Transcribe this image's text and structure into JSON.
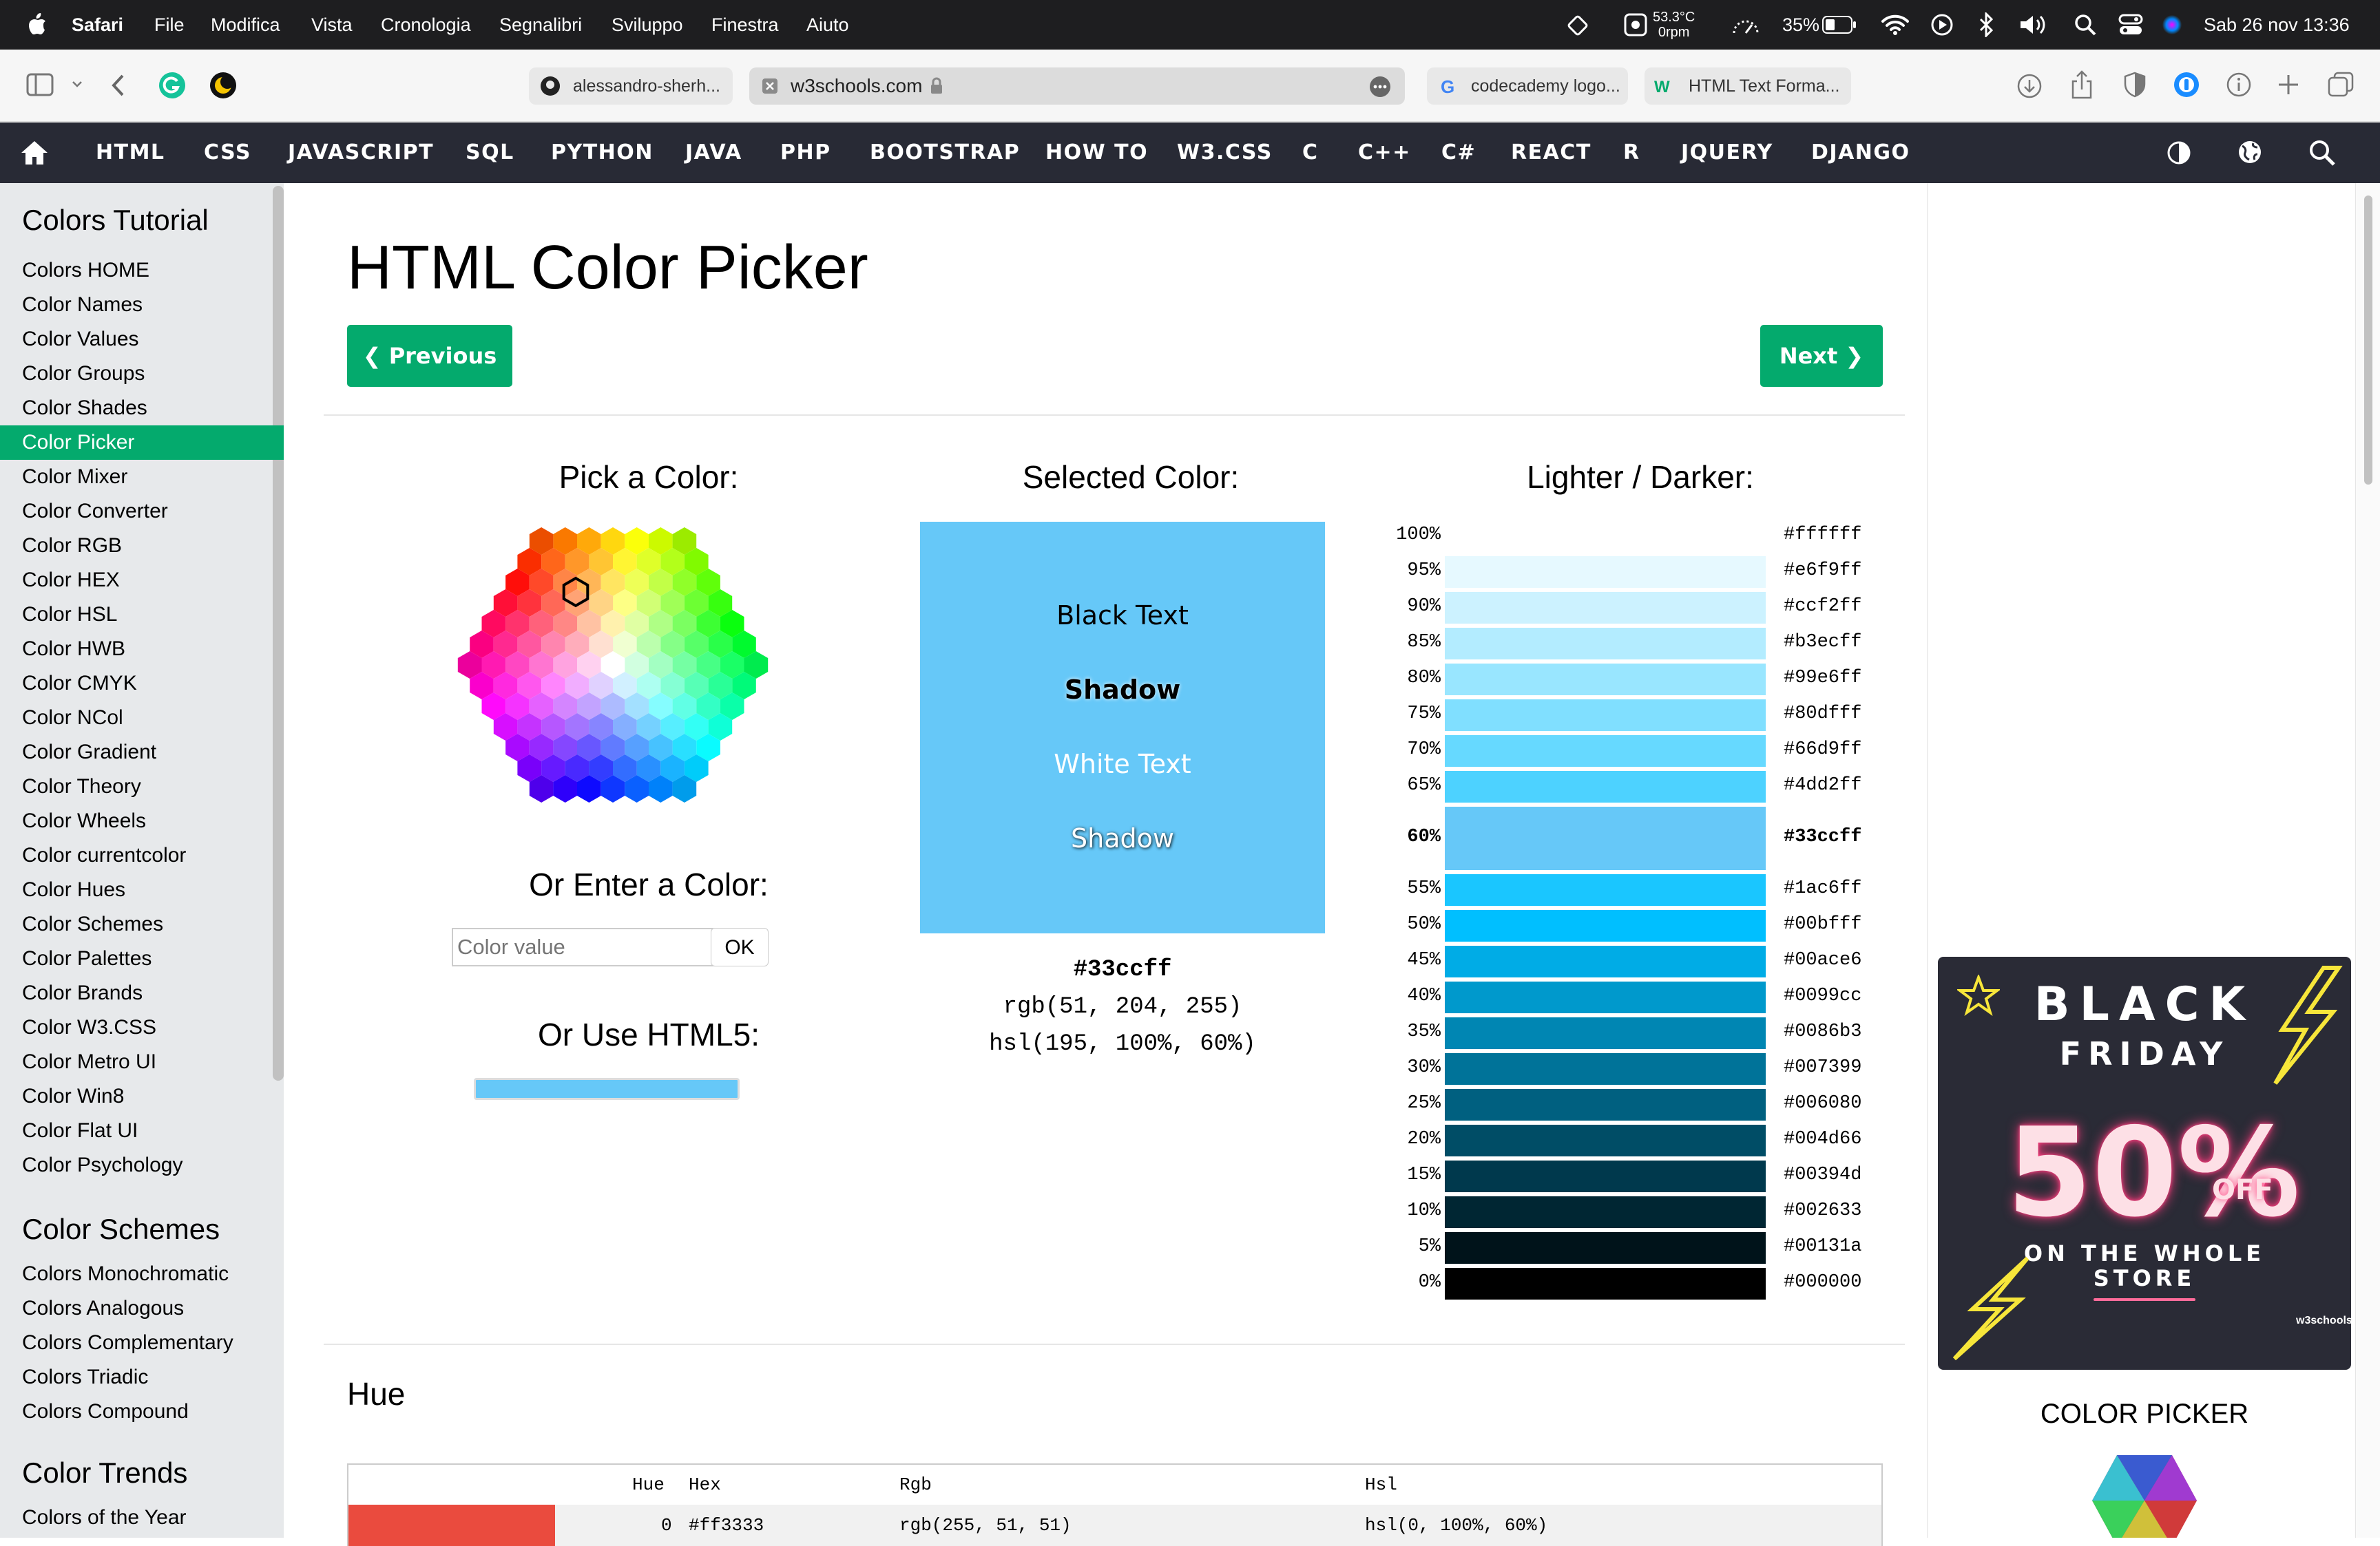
{
  "menubar": {
    "items": [
      "Safari",
      "File",
      "Modifica",
      "Vista",
      "Cronologia",
      "Segnalibri",
      "Sviluppo",
      "Finestra",
      "Aiuto"
    ],
    "temp": "53.3°C",
    "rpm": "0rpm",
    "battery": "35%",
    "datetime": "Sab 26 nov  13:36"
  },
  "tabs": [
    {
      "label": "alessandro-sherh..."
    },
    {
      "label": "w3schools.com"
    },
    {
      "label": "codecademy logo..."
    },
    {
      "label": "HTML Text Forma..."
    }
  ],
  "nav": {
    "items": [
      "HTML",
      "CSS",
      "JAVASCRIPT",
      "SQL",
      "PYTHON",
      "JAVA",
      "PHP",
      "BOOTSTRAP",
      "HOW TO",
      "W3.CSS",
      "C",
      "C++",
      "C#",
      "REACT",
      "R",
      "JQUERY",
      "DJANGO"
    ]
  },
  "sidebar": {
    "heading1": "Colors Tutorial",
    "items1": [
      "Colors HOME",
      "Color Names",
      "Color Values",
      "Color Groups",
      "Color Shades",
      "Color Picker",
      "Color Mixer",
      "Color Converter",
      "Color RGB",
      "Color HEX",
      "Color HSL",
      "Color HWB",
      "Color CMYK",
      "Color NCol",
      "Color Gradient",
      "Color Theory",
      "Color Wheels",
      "Color currentcolor",
      "Color Hues",
      "Color Schemes",
      "Color Palettes",
      "Color Brands",
      "Color W3.CSS",
      "Color Metro UI",
      "Color Win8",
      "Color Flat UI",
      "Color Psychology"
    ],
    "selected": "Color Picker",
    "heading2": "Color Schemes",
    "items2": [
      "Colors Monochromatic",
      "Colors Analogous",
      "Colors Complementary",
      "Colors Triadic",
      "Colors Compound"
    ],
    "heading3": "Color Trends",
    "items3": [
      "Colors of the Year"
    ]
  },
  "page": {
    "title": "HTML Color Picker",
    "prev": "❮ Previous",
    "next": "Next ❯",
    "pick_heading": "Pick a Color:",
    "enter_heading": "Or Enter a Color:",
    "input_placeholder": "Color value",
    "ok": "OK",
    "html5_heading": "Or Use HTML5:",
    "selected_heading": "Selected Color:",
    "selected_color": "#66c8f8",
    "black_text": "Black Text",
    "shadow1": "Shadow",
    "white_text": "White Text",
    "shadow2": "Shadow",
    "hex": "#33ccff",
    "rgb": "rgb(51, 204, 255)",
    "hsl": "hsl(195, 100%, 60%)",
    "lighter_heading": "Lighter / Darker:",
    "hue_heading": "Hue"
  },
  "shades": [
    {
      "pct": "100%",
      "hex": "#ffffff",
      "color": "#ffffff"
    },
    {
      "pct": "95%",
      "hex": "#e6f9ff",
      "color": "#e6f9ff"
    },
    {
      "pct": "90%",
      "hex": "#ccf2ff",
      "color": "#ccf2ff"
    },
    {
      "pct": "85%",
      "hex": "#b3ecff",
      "color": "#b3ecff"
    },
    {
      "pct": "80%",
      "hex": "#99e6ff",
      "color": "#99e6ff"
    },
    {
      "pct": "75%",
      "hex": "#80dfff",
      "color": "#80dfff"
    },
    {
      "pct": "70%",
      "hex": "#66d9ff",
      "color": "#66d9ff"
    },
    {
      "pct": "65%",
      "hex": "#4dd2ff",
      "color": "#4dd2ff"
    },
    {
      "pct": "60%",
      "hex": "#33ccff",
      "color": "#66c8f8",
      "selected": true
    },
    {
      "pct": "55%",
      "hex": "#1ac6ff",
      "color": "#1ac6ff"
    },
    {
      "pct": "50%",
      "hex": "#00bfff",
      "color": "#00bfff"
    },
    {
      "pct": "45%",
      "hex": "#00ace6",
      "color": "#00ace6"
    },
    {
      "pct": "40%",
      "hex": "#0099cc",
      "color": "#0099cc"
    },
    {
      "pct": "35%",
      "hex": "#0086b3",
      "color": "#0086b3"
    },
    {
      "pct": "30%",
      "hex": "#007399",
      "color": "#007399"
    },
    {
      "pct": "25%",
      "hex": "#006080",
      "color": "#006080"
    },
    {
      "pct": "20%",
      "hex": "#004d66",
      "color": "#004d66"
    },
    {
      "pct": "15%",
      "hex": "#00394d",
      "color": "#00394d"
    },
    {
      "pct": "10%",
      "hex": "#002633",
      "color": "#002633"
    },
    {
      "pct": "5%",
      "hex": "#00131a",
      "color": "#00131a"
    },
    {
      "pct": "0%",
      "hex": "#000000",
      "color": "#000000"
    }
  ],
  "hue_table": {
    "headers": [
      "Hue",
      "Hex",
      "Rgb",
      "Hsl"
    ],
    "row": {
      "swatch": "#ea4b3e",
      "hue": "0",
      "hex": "#ff3333",
      "rgb": "rgb(255, 51, 51)",
      "hsl": "hsl(0, 100%, 60%)"
    }
  },
  "ad": {
    "black": "BLACK",
    "friday": "FRIDAY",
    "percent": "50%",
    "off": "OFF",
    "line1": "ON THE WHOLE",
    "line2": "STORE",
    "logo": "w3schools"
  },
  "picker_label": "COLOR PICKER",
  "colors": {
    "accent": "#04aa6d",
    "nav_bg": "#282a35",
    "sidebar_bg": "#e7e9eb"
  }
}
